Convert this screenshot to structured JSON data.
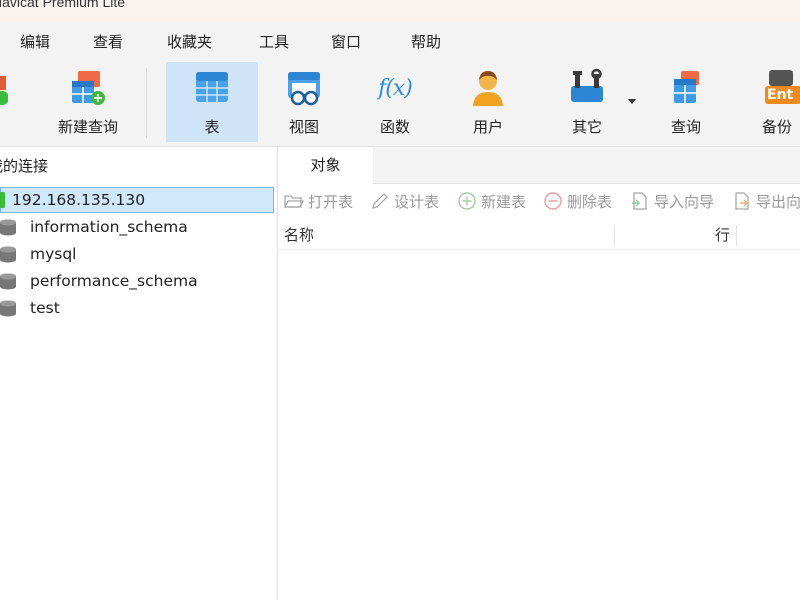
{
  "window": {
    "title": "Navicat Premium Lite"
  },
  "menu": [
    "编辑",
    "查看",
    "收藏夹",
    "工具",
    "窗口",
    "帮助"
  ],
  "toolbar": {
    "buttons": [
      {
        "label": "新建查询",
        "icon": "new-query-icon"
      },
      {
        "label": "表",
        "icon": "table-icon",
        "active": true
      },
      {
        "label": "视图",
        "icon": "view-icon"
      },
      {
        "label": "函数",
        "icon": "function-icon"
      },
      {
        "label": "用户",
        "icon": "user-icon"
      },
      {
        "label": "其它",
        "icon": "other-tools-icon"
      },
      {
        "label": "查询",
        "icon": "query-icon"
      },
      {
        "label": "备份",
        "icon": "backup-icon"
      }
    ],
    "function_glyph": "f(x)",
    "backup_glyph": "Ent"
  },
  "connections": {
    "header": "我的连接",
    "server": "192.168.135.130",
    "databases": [
      "information_schema",
      "mysql",
      "performance_schema",
      "test"
    ]
  },
  "objects": {
    "tab_label": "对象",
    "toolbar": [
      "打开表",
      "设计表",
      "新建表",
      "删除表",
      "导入向导",
      "导出向导"
    ],
    "columns": [
      "名称",
      "行"
    ]
  },
  "colors": {
    "accent": "#2b8fe0",
    "selection": "#cfe8fb",
    "active_toolbar": "#cfe4f7",
    "status_green": "#3dbb3d"
  }
}
